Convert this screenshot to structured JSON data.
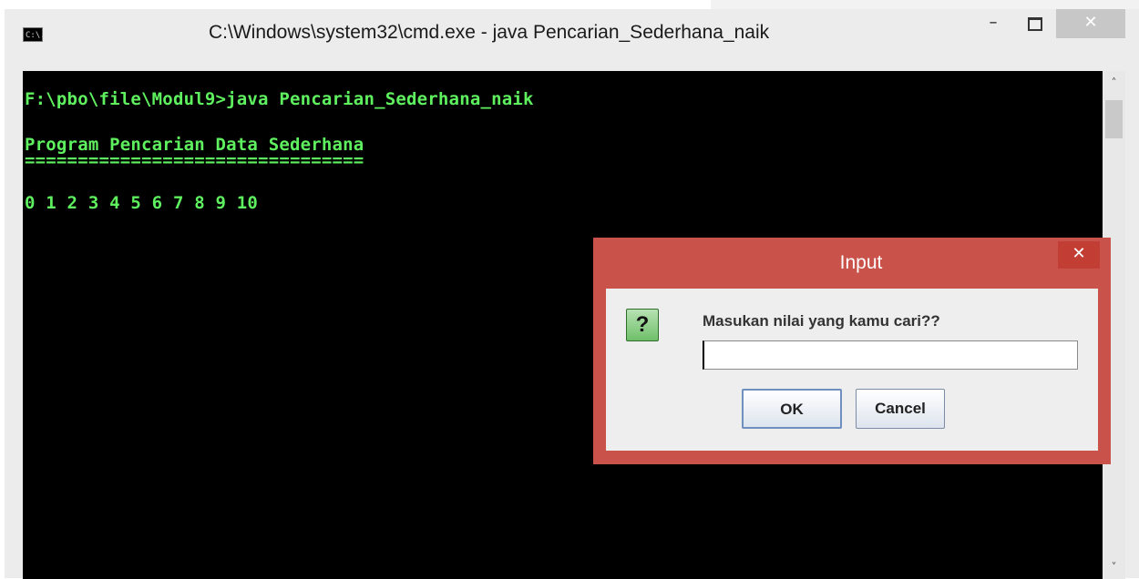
{
  "window": {
    "title": "C:\\Windows\\system32\\cmd.exe - java  Pencarian_Sederhana_naik",
    "icon_label": "C:\\.",
    "minimize_icon": "minimize-icon",
    "maximize_icon": "maximize-icon",
    "close_glyph": "✕",
    "minimize_glyph": "–"
  },
  "console": {
    "lines": [
      "F:\\pbo\\file\\Modul9>java Pencarian_Sederhana_naik",
      "Program Pencarian Data Sederhana",
      "================================",
      "0 1 2 3 4 5 6 7 8 9 10"
    ],
    "text_color": "#5ff05f",
    "background": "#000000"
  },
  "scrollbar": {
    "up_glyph": "˄",
    "down_glyph": "˅"
  },
  "dialog": {
    "title": "Input",
    "close_glyph": "✕",
    "question_glyph": "?",
    "prompt": "Masukan nilai yang kamu cari??",
    "input_value": "",
    "ok_label": "OK",
    "cancel_label": "Cancel",
    "frame_color": "#c9524a"
  }
}
